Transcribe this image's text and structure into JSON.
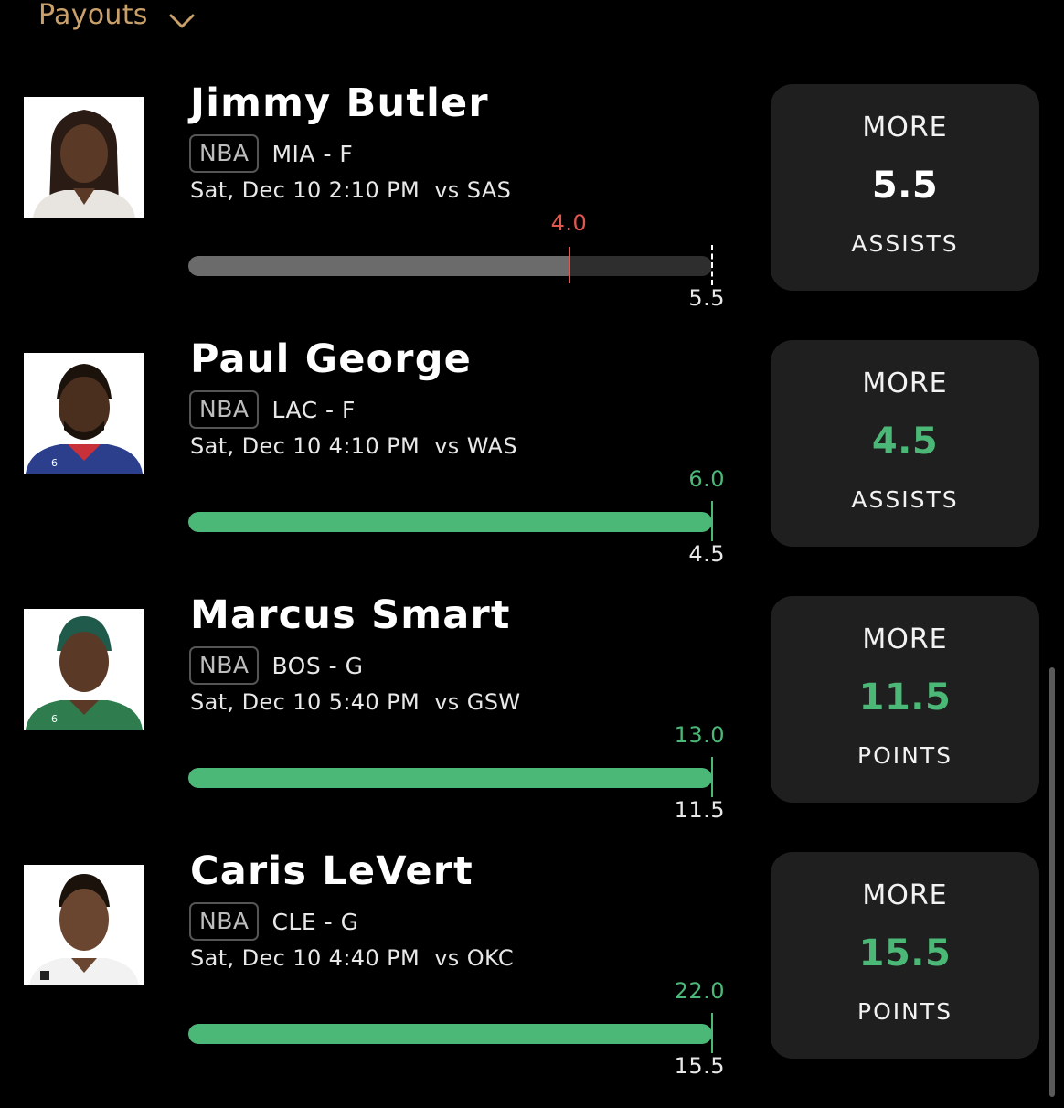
{
  "header": {
    "label": "Payouts",
    "icon": "chevron-down-icon",
    "color": "#c9a06a"
  },
  "colors": {
    "hit": "#4cb877",
    "miss": "#e0574f",
    "neutral_bar": "#6b6b6b",
    "card_bg": "#1f1f1f"
  },
  "picks": [
    {
      "name": "Jimmy Butler",
      "league": "NBA",
      "team_pos": "MIA - F",
      "game": "Sat, Dec 10 2:10 PM  vs SAS",
      "result": "4.0",
      "result_fraction": 0.727,
      "status": "miss",
      "line": "5.5",
      "direction": "MORE",
      "stat": "ASSISTS"
    },
    {
      "name": "Paul George",
      "league": "NBA",
      "team_pos": "LAC - F",
      "game": "Sat, Dec 10 4:10 PM  vs WAS",
      "result": "6.0",
      "result_fraction": 1.0,
      "status": "hit",
      "line": "4.5",
      "direction": "MORE",
      "stat": "ASSISTS"
    },
    {
      "name": "Marcus Smart",
      "league": "NBA",
      "team_pos": "BOS - G",
      "game": "Sat, Dec 10 5:40 PM  vs GSW",
      "result": "13.0",
      "result_fraction": 1.0,
      "status": "hit",
      "line": "11.5",
      "direction": "MORE",
      "stat": "POINTS"
    },
    {
      "name": "Caris LeVert",
      "league": "NBA",
      "team_pos": "CLE - G",
      "game": "Sat, Dec 10 4:40 PM  vs OKC",
      "result": "22.0",
      "result_fraction": 1.0,
      "status": "hit",
      "line": "15.5",
      "direction": "MORE",
      "stat": "POINTS"
    }
  ]
}
